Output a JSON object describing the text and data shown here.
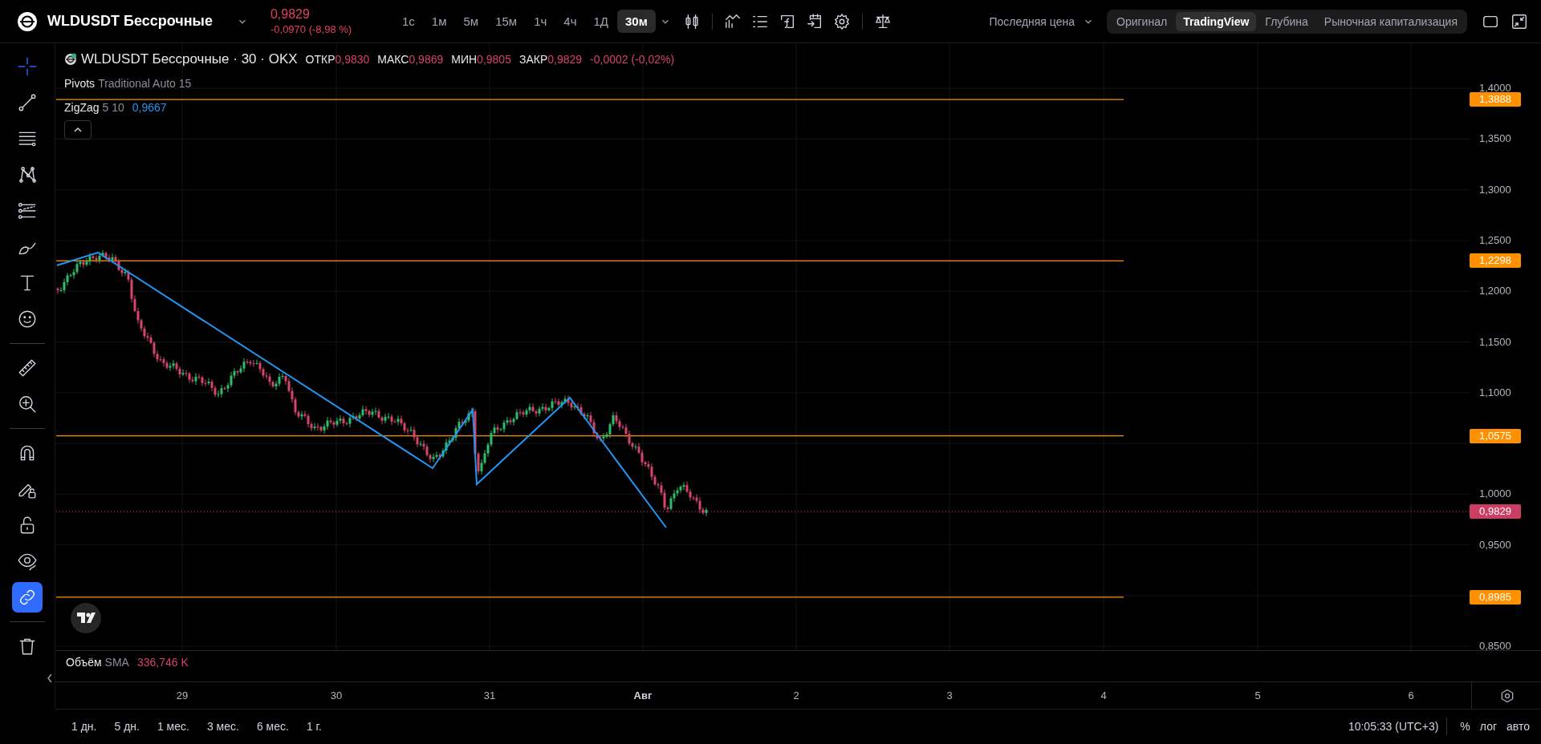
{
  "header": {
    "symbol": "WLDUSDT Бессрочные",
    "price": "0,9829",
    "change": "-0,0970 (-8,98 %)",
    "intervals": [
      {
        "label": "1с",
        "selected": false
      },
      {
        "label": "1м",
        "selected": false
      },
      {
        "label": "5м",
        "selected": false
      },
      {
        "label": "15м",
        "selected": false
      },
      {
        "label": "1ч",
        "selected": false
      },
      {
        "label": "4ч",
        "selected": false
      },
      {
        "label": "1Д",
        "selected": false
      },
      {
        "label": "30м",
        "selected": true
      }
    ],
    "price_source": "Последняя цена",
    "views": [
      {
        "label": "Оригинал",
        "selected": false
      },
      {
        "label": "TradingView",
        "selected": true
      },
      {
        "label": "Глубина",
        "selected": false
      },
      {
        "label": "Рыночная капитализация",
        "selected": false
      }
    ]
  },
  "left_toolbar": {
    "tools": [
      {
        "selected": true
      },
      {
        "selected": false
      },
      {
        "selected": false
      },
      {
        "selected": false
      },
      {
        "selected": false
      },
      {
        "selected": false
      },
      {
        "selected": false
      },
      {
        "selected": false
      },
      {
        "selected": false
      },
      {
        "selected": false
      }
    ],
    "toggles": [
      {
        "on": false
      },
      {
        "on": false
      },
      {
        "on": false
      },
      {
        "on": false
      },
      {
        "on": true
      }
    ]
  },
  "legend": {
    "title": "WLDUSDT Бессрочные · 30 · OKX",
    "ohlc": [
      {
        "label": "ОТКР",
        "value": "0,9830"
      },
      {
        "label": "МАКС",
        "value": "0,9869"
      },
      {
        "label": "МИН",
        "value": "0,9805"
      },
      {
        "label": "ЗАКР",
        "value": "0,9829"
      }
    ],
    "change": "-0,0002 (-0,02%)",
    "indicators": [
      {
        "name": "Pivots",
        "params": "Traditional Auto 15"
      },
      {
        "name": "ZigZag",
        "params": "5 10",
        "value": "0,9667"
      }
    ]
  },
  "price_axis": {
    "ticks": [
      "1,4000",
      "1,3500",
      "1,3000",
      "1,2500",
      "1,2000",
      "1,1500",
      "1,1000",
      "1,0000",
      "0,9500",
      "0,8500"
    ],
    "badges": [
      {
        "kind": "pivot",
        "label": "1,3888",
        "color": "#ff9100"
      },
      {
        "kind": "pivot",
        "label": "1,2298",
        "color": "#ff9100"
      },
      {
        "kind": "pivot",
        "label": "1,0575",
        "color": "#ff9100"
      },
      {
        "kind": "last_price",
        "label": "0,9829",
        "color": "#cc3d63"
      },
      {
        "kind": "pivot",
        "label": "0,8985",
        "color": "#ff9100"
      }
    ]
  },
  "volume": {
    "name": "Объём",
    "params": "SMA",
    "value": "336,746 K"
  },
  "time_axis": {
    "labels": [
      {
        "label": "29",
        "kind": "day"
      },
      {
        "label": "30",
        "kind": "day"
      },
      {
        "label": "31",
        "kind": "day"
      },
      {
        "label": "Авг",
        "kind": "month"
      },
      {
        "label": "2",
        "kind": "day"
      },
      {
        "label": "3",
        "kind": "day"
      },
      {
        "label": "4",
        "kind": "day"
      },
      {
        "label": "5",
        "kind": "day"
      },
      {
        "label": "6",
        "kind": "day"
      }
    ]
  },
  "bottom_bar": {
    "ranges": [
      "1 дн.",
      "5 дн.",
      "1 мес.",
      "3 мес.",
      "6 мес.",
      "1 г."
    ],
    "clock": "10:05:33 (UTC+3)",
    "scale_options": [
      "%",
      "лог",
      "авто"
    ]
  }
}
